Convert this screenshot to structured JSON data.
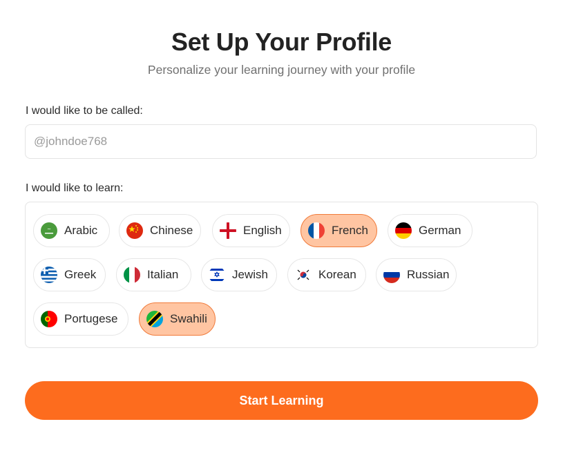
{
  "header": {
    "title": "Set Up Your Profile",
    "subtitle": "Personalize your learning journey with your profile"
  },
  "name_section": {
    "label": "I would like to be called:",
    "placeholder": "@johndoe768",
    "value": ""
  },
  "learn_section": {
    "label": "I would like to learn:",
    "languages": [
      {
        "label": "Arabic",
        "icon": "saudi-arabia-flag-icon",
        "selected": false
      },
      {
        "label": "Chinese",
        "icon": "china-flag-icon",
        "selected": false
      },
      {
        "label": "English",
        "icon": "england-flag-icon",
        "selected": false
      },
      {
        "label": "French",
        "icon": "france-flag-icon",
        "selected": true
      },
      {
        "label": "German",
        "icon": "germany-flag-icon",
        "selected": false
      },
      {
        "label": "Greek",
        "icon": "greece-flag-icon",
        "selected": false
      },
      {
        "label": "Italian",
        "icon": "italy-flag-icon",
        "selected": false
      },
      {
        "label": "Jewish",
        "icon": "israel-flag-icon",
        "selected": false
      },
      {
        "label": "Korean",
        "icon": "south-korea-flag-icon",
        "selected": false
      },
      {
        "label": "Russian",
        "icon": "russia-flag-icon",
        "selected": false
      },
      {
        "label": "Portugese",
        "icon": "portugal-flag-icon",
        "selected": false
      },
      {
        "label": "Swahili",
        "icon": "tanzania-flag-icon",
        "selected": true
      }
    ]
  },
  "footer": {
    "start_label": "Start Learning"
  },
  "colors": {
    "accent": "#fd6c1e",
    "selected_chip_bg": "#ffc5a2",
    "selected_chip_border": "#f07a3a",
    "border": "#e3e3e3"
  }
}
